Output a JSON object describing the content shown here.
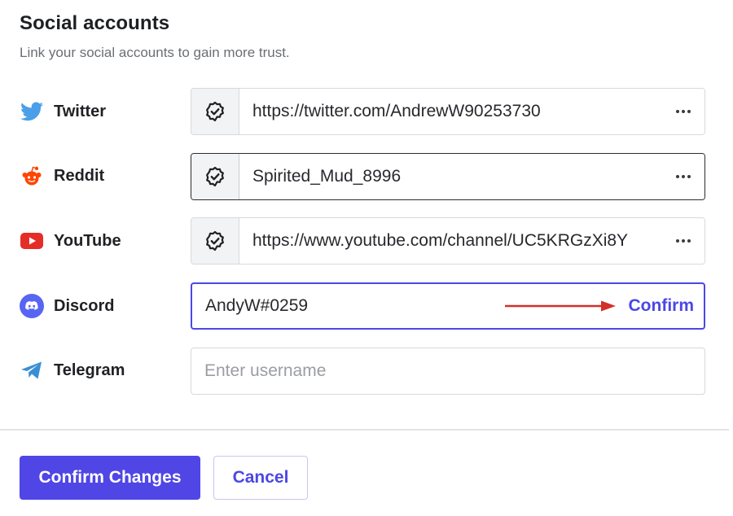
{
  "header": {
    "title": "Social accounts",
    "subtitle": "Link your social accounts to gain more trust."
  },
  "accounts": [
    {
      "label": "Twitter",
      "icon": "twitter-bird-icon",
      "value": "https://twitter.com/AndrewW90253730",
      "verified": true
    },
    {
      "label": "Reddit",
      "icon": "reddit-alien-icon",
      "value": "Spirited_Mud_8996",
      "verified": true
    },
    {
      "label": "YouTube",
      "icon": "youtube-play-icon",
      "value": "https://www.youtube.com/channel/UC5KRGzXi8Y",
      "verified": true
    },
    {
      "label": "Discord",
      "icon": "discord-icon",
      "value": "AndyW#0259",
      "action": "Confirm"
    },
    {
      "label": "Telegram",
      "icon": "telegram-plane-icon",
      "placeholder": "Enter username"
    }
  ],
  "footer": {
    "confirm_label": "Confirm Changes",
    "cancel_label": "Cancel"
  },
  "colors": {
    "accent": "#4f46e5",
    "arrow": "#d2302a",
    "twitter": "#4a9fe8",
    "reddit": "#ff4500",
    "youtube": "#e52d27",
    "discord": "#5865f2",
    "telegram": "#3a8ed6"
  }
}
